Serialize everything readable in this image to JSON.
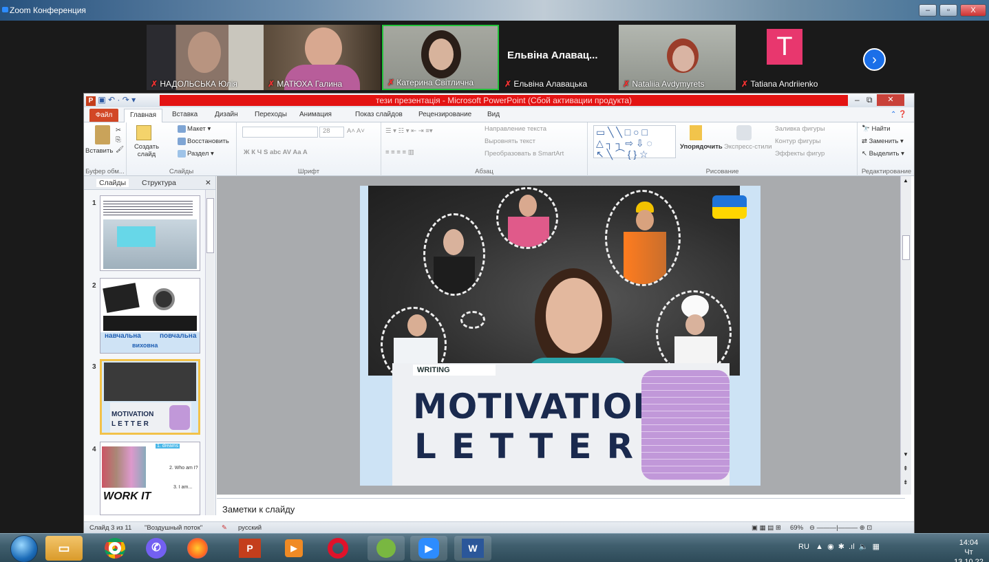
{
  "zoom": {
    "title": "Zoom Конференция",
    "participants": [
      {
        "name": "НАДОЛЬСЬКА Юлія",
        "muted": true
      },
      {
        "name": "МАТЮХА Галина",
        "muted": true
      },
      {
        "name": "Катерина Світлична",
        "muted": false,
        "active": true
      },
      {
        "name": "Ельвіна Алавацька",
        "muted": true,
        "big_label": "Ельвіна Алавац..."
      },
      {
        "name": "Nataliia Avdymyrets",
        "muted": true
      },
      {
        "name": "Tatiana Andriienko",
        "muted": true,
        "initial": "T"
      }
    ],
    "window_controls": [
      "–",
      "▫",
      "X"
    ]
  },
  "powerpoint": {
    "title": "тези презентація - Microsoft PowerPoint (Сбой активации продукта)",
    "tabs": [
      "Файл",
      "Главная",
      "Вставка",
      "Дизайн",
      "Переходы",
      "Анимация",
      "Показ слайдов",
      "Рецензирование",
      "Вид"
    ],
    "ribbon": {
      "clipboard": {
        "paste": "Вставить",
        "group": "Буфер обм..."
      },
      "slides": {
        "new_slide": "Создать слайд",
        "layout": "Макет",
        "reset": "Восстановить",
        "section": "Раздел",
        "group": "Слайды"
      },
      "font": {
        "size": "28",
        "group": "Шрифт"
      },
      "paragraph": {
        "text_direction": "Направление текста",
        "align_text": "Выровнять текст",
        "smartart": "Преобразовать в SmartArt",
        "group": "Абзац"
      },
      "drawing": {
        "arrange": "Упорядочить",
        "quick_styles": "Экспресс-стили",
        "fill": "Заливка фигуры",
        "outline": "Контур фигуры",
        "effects": "Эффекты фигур",
        "group": "Рисование"
      },
      "editing": {
        "find": "Найти",
        "replace": "Заменить",
        "select": "Выделить",
        "group": "Редактирование"
      }
    },
    "panel_tabs": [
      "Слайды",
      "Структура"
    ],
    "slide_numbers": [
      "1",
      "2",
      "3",
      "4"
    ],
    "thumb2": {
      "line1": "навчальна",
      "line2": "повчальна",
      "line3": "виховна"
    },
    "thumb3": {
      "line1": "MOTIVATION",
      "line2": "LETTER"
    },
    "thumb4": {
      "label": "1. dreams",
      "l2": "2. Who am I?",
      "l3": "3. I am...",
      "big": "WORK IT"
    },
    "slide": {
      "tag": "WRITING",
      "title1": "MOTIVATION",
      "title2": "LETTER"
    },
    "notes_placeholder": "Заметки к слайду",
    "status": {
      "slide": "Слайд 3 из 11",
      "theme": "\"Воздушный поток\"",
      "lang": "русский",
      "zoom": "69%"
    }
  },
  "taskbar": {
    "lang": "RU",
    "time": "14:04",
    "date": "Чт 13.10.22"
  }
}
